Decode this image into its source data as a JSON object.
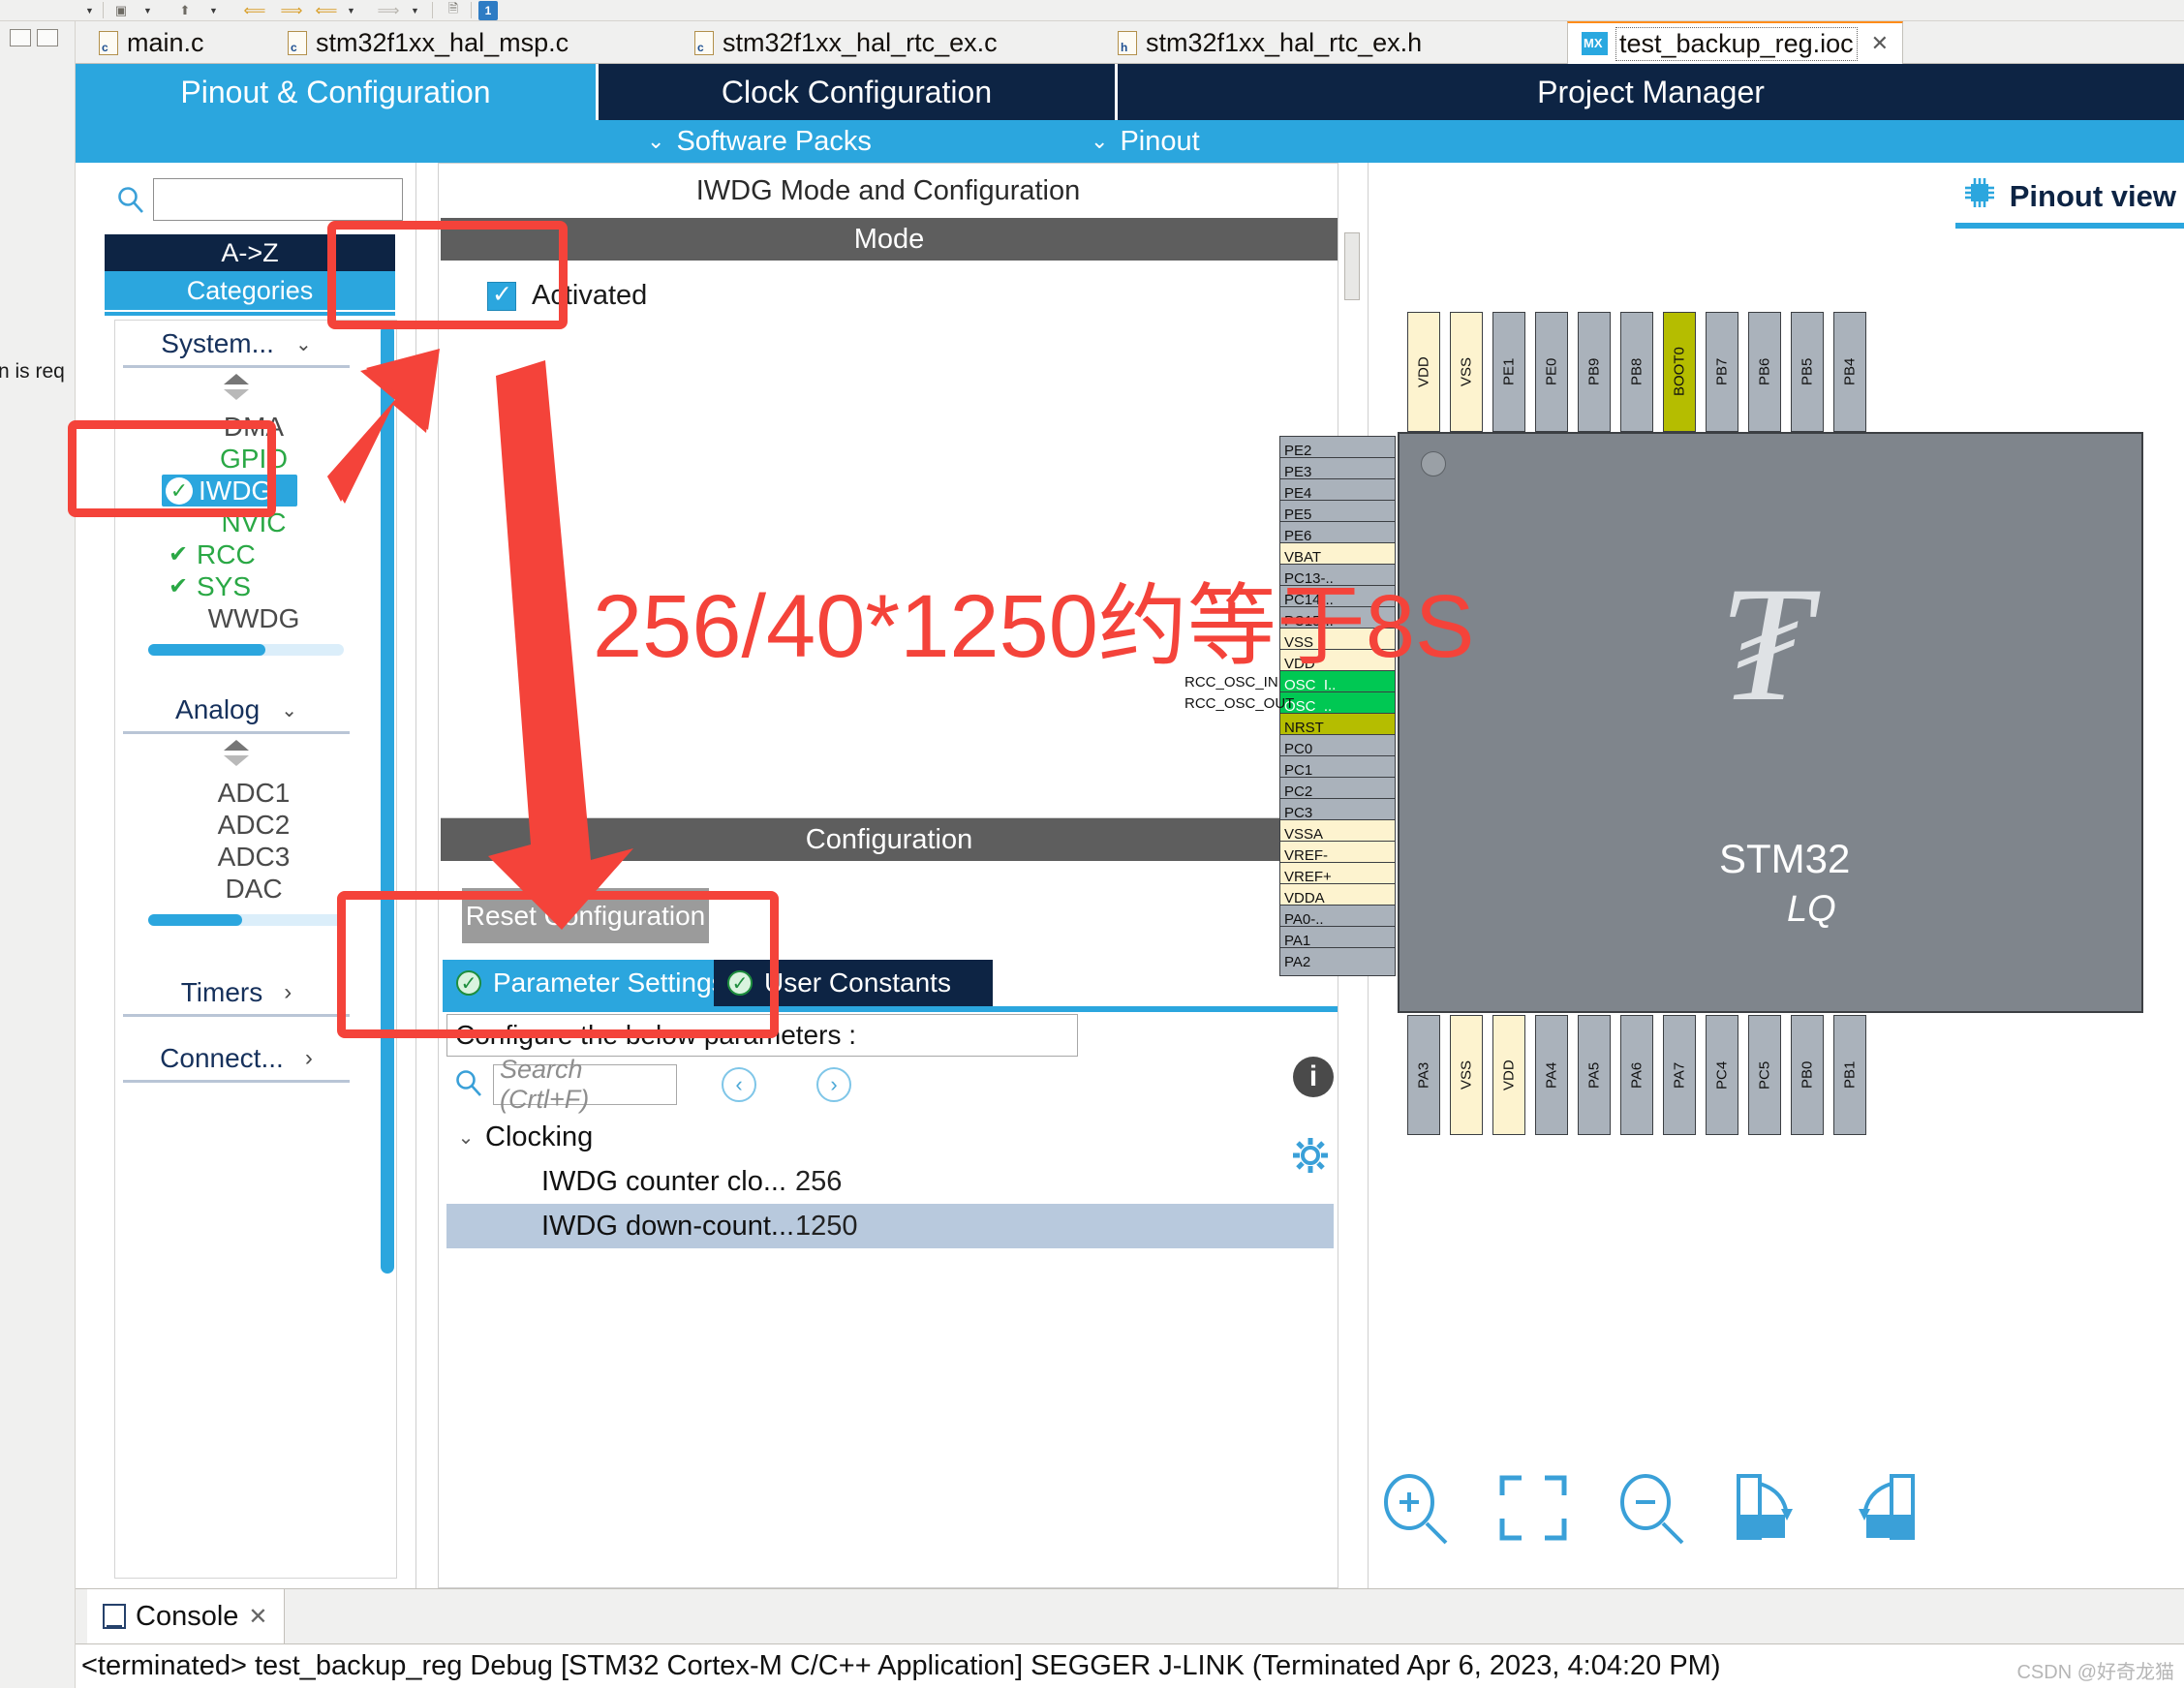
{
  "toolbar": {
    "badge": "1",
    "icons": [
      "run-icon",
      "caret-down-icon",
      "up-arrow-icon",
      "caret-down-icon",
      "back-arrow-icon",
      "forward-arrow-icon",
      "back-arrow-icon",
      "caret-down-icon",
      "forward-arrow-gray-icon",
      "caret-down-icon",
      "new-window-icon"
    ]
  },
  "rail": {
    "tooltip": "n is req"
  },
  "editor_tabs": [
    {
      "label": "main.c",
      "icon": "c-file-icon",
      "active": false
    },
    {
      "label": "stm32f1xx_hal_msp.c",
      "icon": "c-file-icon",
      "active": false
    },
    {
      "label": "stm32f1xx_hal_rtc_ex.c",
      "icon": "c-file-icon",
      "active": false
    },
    {
      "label": "stm32f1xx_hal_rtc_ex.h",
      "icon": "h-file-icon",
      "active": false
    },
    {
      "label": "test_backup_reg.ioc",
      "icon": "mx-file-icon",
      "active": true,
      "close": "✕"
    }
  ],
  "cube": {
    "tabs": [
      {
        "label": "Pinout & Configuration",
        "selected": true
      },
      {
        "label": "Clock Configuration",
        "selected": false
      },
      {
        "label": "Project Manager",
        "selected": false
      }
    ],
    "subbar": [
      {
        "label": "Software Packs",
        "chevron": "⌄"
      },
      {
        "label": "Pinout",
        "chevron": "⌄"
      }
    ]
  },
  "sidebar": {
    "search_value": "",
    "az_label": "A->Z",
    "categories_label": "Categories",
    "groups": [
      {
        "name": "System...",
        "chevron": "⌄",
        "items": [
          {
            "label": "DMA",
            "state": "none"
          },
          {
            "label": "GPIO",
            "state": "ok"
          },
          {
            "label": "IWDG",
            "state": "ok",
            "selected": true
          },
          {
            "label": "NVIC",
            "state": "ok"
          },
          {
            "label": "RCC",
            "state": "check"
          },
          {
            "label": "SYS",
            "state": "check"
          },
          {
            "label": "WWDG",
            "state": "none"
          }
        ]
      },
      {
        "name": "Analog",
        "chevron": "⌄",
        "items": [
          {
            "label": "ADC1",
            "state": "none"
          },
          {
            "label": "ADC2",
            "state": "none"
          },
          {
            "label": "ADC3",
            "state": "none"
          },
          {
            "label": "DAC",
            "state": "none"
          }
        ]
      },
      {
        "name": "Timers",
        "chevron": "›",
        "items": []
      },
      {
        "name": "Connect...",
        "chevron": "›",
        "items": []
      }
    ]
  },
  "center": {
    "title": "IWDG Mode and Configuration",
    "mode_header": "Mode",
    "activated_label": "Activated",
    "activated_checked": true,
    "config_header": "Configuration",
    "reset_button": "Reset Configuration",
    "param_tabs": [
      {
        "label": "Parameter Settings",
        "selected": true
      },
      {
        "label": "User Constants",
        "selected": false
      }
    ],
    "configure_banner": "Configure the below parameters :",
    "search_placeholder": "Search (Crtl+F)",
    "params": [
      {
        "indent": 0,
        "twisty": "⌄",
        "name": "Clocking",
        "value": "",
        "selected": false
      },
      {
        "indent": 1,
        "twisty": "",
        "name": "IWDG counter clo...",
        "value": "256",
        "selected": false
      },
      {
        "indent": 1,
        "twisty": "",
        "name": "IWDG down-count...",
        "value": "1250",
        "selected": true
      }
    ]
  },
  "pinout": {
    "view_label": "Pinout view",
    "chip_name": "STM32",
    "chip_package": "LQ",
    "top_pins": [
      "VDD",
      "VSS",
      "PE1",
      "PE0",
      "PB9",
      "PB8",
      "BOOT0",
      "PB7",
      "PB6",
      "PB5",
      "PB4"
    ],
    "left_pins": [
      "PE2",
      "PE3",
      "PE4",
      "PE5",
      "PE6",
      "VBAT",
      "PC13-..",
      "PC14-..",
      "PC15-..",
      "VSS",
      "VDD",
      "OSC_I..",
      "OSC_..",
      "NRST",
      "PC0",
      "PC1",
      "PC2",
      "PC3",
      "VSSA",
      "VREF-",
      "VREF+",
      "VDDA",
      "PA0-..",
      "PA1",
      "PA2"
    ],
    "bottom_pins": [
      "PA3",
      "VSS",
      "VDD",
      "PA4",
      "PA5",
      "PA6",
      "PA7",
      "PC4",
      "PC5",
      "PB0",
      "PB1"
    ],
    "osc_labels": [
      "RCC_OSC_IN",
      "RCC_OSC_OUT"
    ],
    "zoom_tools": [
      "zoom-in-icon",
      "fit-to-screen-icon",
      "zoom-out-icon",
      "rotate-right-icon",
      "rotate-left-icon"
    ]
  },
  "console": {
    "tab_label": "Console",
    "close": "✕",
    "text": "<terminated> test_backup_reg Debug [STM32 Cortex-M C/C++ Application] SEGGER J-LINK (Terminated Apr 6, 2023, 4:04:20 PM)",
    "watermark": "CSDN @好奇龙猫"
  },
  "annotation": {
    "formula": "256/40*1250约等于8S",
    "color": "#f4433a"
  }
}
